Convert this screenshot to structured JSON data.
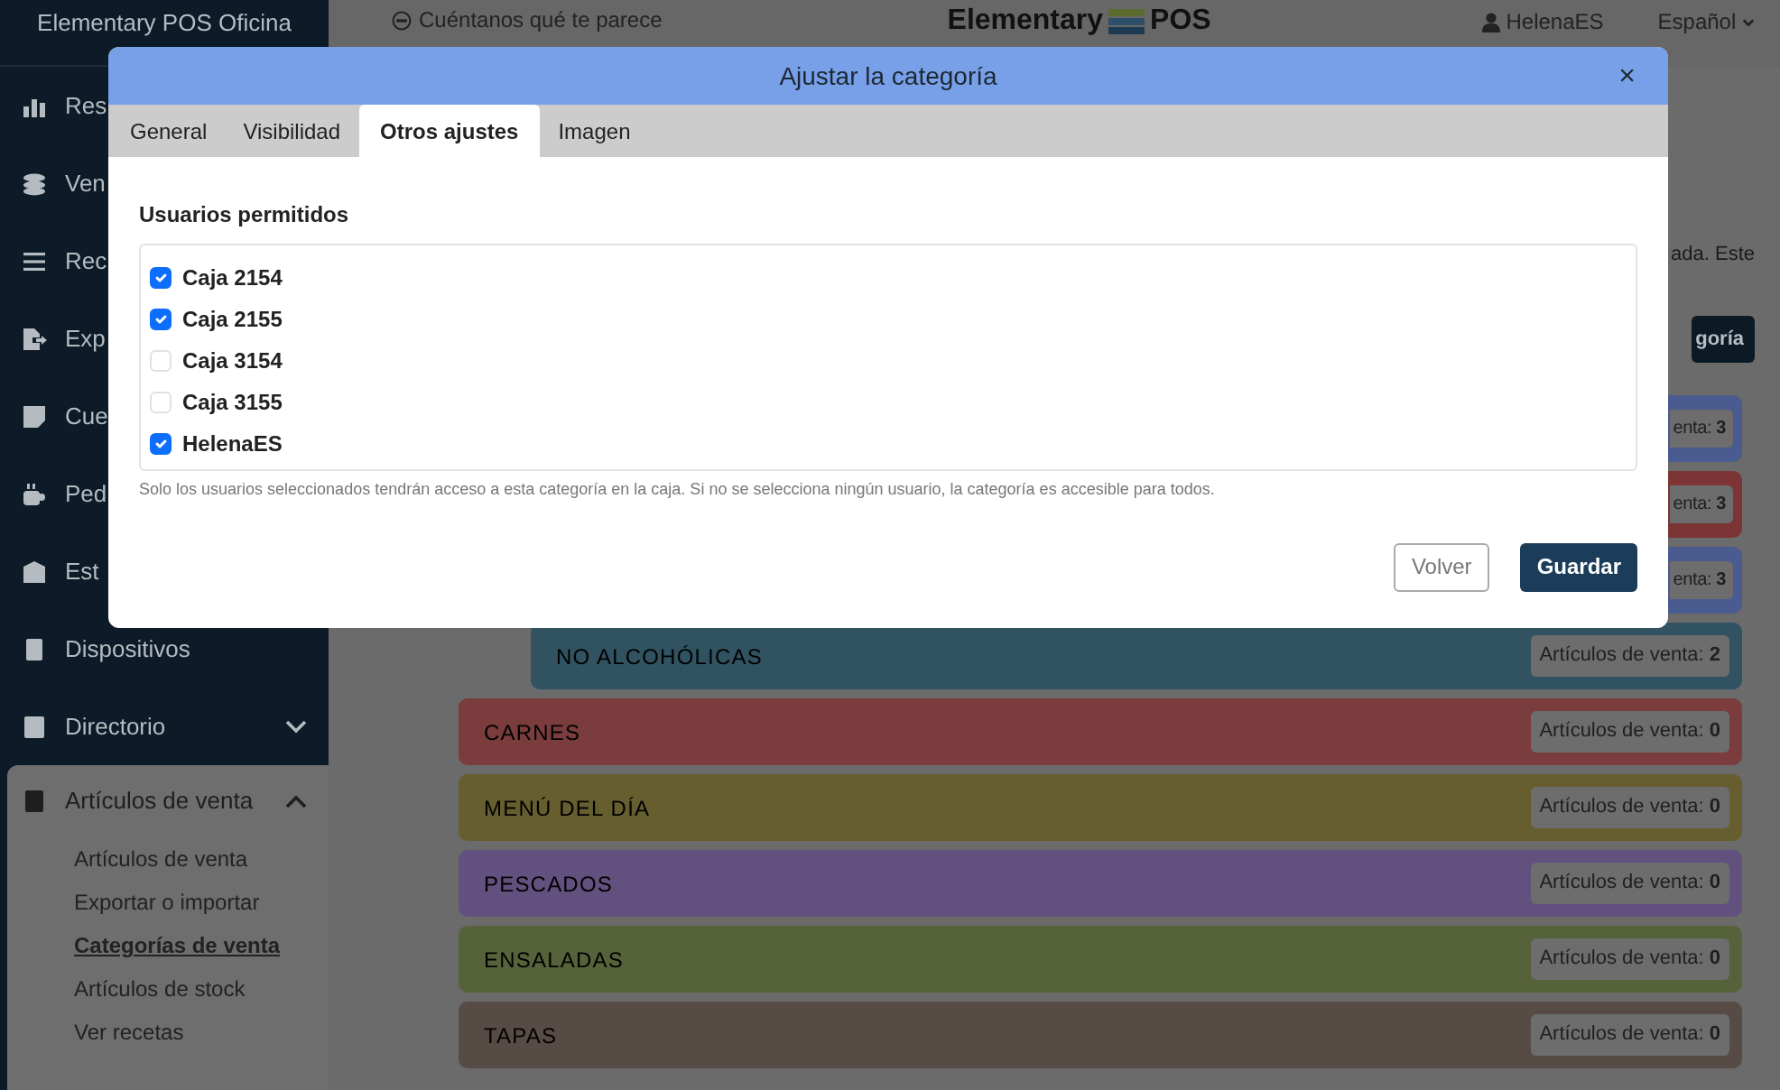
{
  "sidebar": {
    "title": "Elementary POS Oficina",
    "items": [
      {
        "label": "Res"
      },
      {
        "label": "Ven"
      },
      {
        "label": "Rec"
      },
      {
        "label": "Exp"
      },
      {
        "label": "Cue"
      },
      {
        "label": "Ped"
      },
      {
        "label": "Est"
      },
      {
        "label": "Dispositivos"
      },
      {
        "label": "Directorio",
        "expanded": false
      },
      {
        "label": "Artículos de venta",
        "expanded": true,
        "children": [
          {
            "label": "Artículos de venta",
            "selected": false
          },
          {
            "label": "Exportar o importar",
            "selected": false
          },
          {
            "label": "Categorías de venta",
            "selected": true
          },
          {
            "label": "Artículos de stock",
            "selected": false
          },
          {
            "label": "Ver recetas",
            "selected": false
          }
        ]
      }
    ]
  },
  "topbar": {
    "feedback": "Cuéntanos qué te parece",
    "logo_left": "Elementary",
    "logo_right": "POS",
    "user": "HelenaES",
    "language": "Español"
  },
  "main": {
    "description": "ada. Este",
    "add_button": "goría",
    "subcategories": [
      {
        "badge": "enta: **3**",
        "color": "#4a5b8f"
      },
      {
        "badge": "enta: **3**",
        "color": "#7c3434"
      },
      {
        "badge": "enta: **3**",
        "color": "#4a5b8f"
      },
      {
        "name": "NO ALCOHÓLICAS",
        "badge": "Artículos de venta: **2**",
        "color": "#315361"
      }
    ],
    "categories": [
      {
        "name": "CARNES",
        "badge": "Artículos de venta: **0**",
        "color": "#7a3c3c"
      },
      {
        "name": "MENÚ DEL DÍA",
        "badge": "Artículos de venta: **0**",
        "color": "#665e2f"
      },
      {
        "name": "PESCADOS",
        "badge": "Artículos de venta: **0**",
        "color": "#62507e"
      },
      {
        "name": "ENSALADAS",
        "badge": "Artículos de venta: **0**",
        "color": "#55623a"
      },
      {
        "name": "TAPAS",
        "badge": "Artículos de venta: **0**",
        "color": "#574b46"
      }
    ]
  },
  "modal": {
    "title": "Ajustar la categoría",
    "close": "×",
    "tabs": [
      {
        "label": "General",
        "selected": false
      },
      {
        "label": "Visibilidad",
        "selected": false
      },
      {
        "label": "Otros ajustes",
        "selected": true
      },
      {
        "label": "Imagen",
        "selected": false
      }
    ],
    "users_label": "Usuarios permitidos",
    "users": [
      {
        "label": "Caja 2154",
        "checked": true
      },
      {
        "label": "Caja 2155",
        "checked": true
      },
      {
        "label": "Caja 3154",
        "checked": false
      },
      {
        "label": "Caja 3155",
        "checked": false
      },
      {
        "label": "HelenaES",
        "checked": true
      }
    ],
    "help": "Solo los usuarios seleccionados tendrán acceso a esta categoría en la caja. Si no se selecciona ningún usuario, la categoría es accesible para todos.",
    "buttons": [
      {
        "label": "Volver",
        "kind": "secondary"
      },
      {
        "label": "Guardar",
        "kind": "primary"
      }
    ]
  }
}
